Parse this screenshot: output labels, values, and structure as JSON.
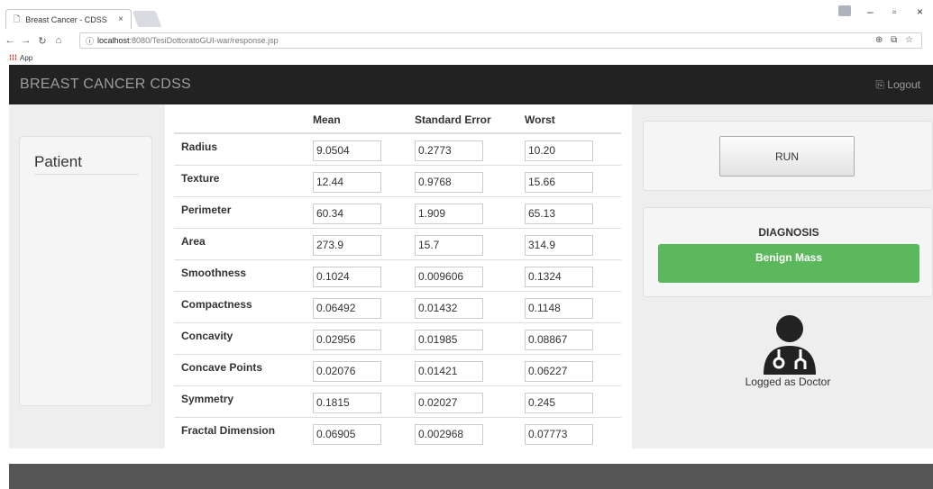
{
  "browser": {
    "tab_title": "Breast Cancer - CDSS",
    "tab_close": "×",
    "url_host": "localhost",
    "url_path": ":8080/TesiDottoratoGUI-war/response.jsp",
    "bookmark_app": "App",
    "window_min": "–",
    "window_max": "▫",
    "window_close": "×"
  },
  "navbar": {
    "brand": "BREAST CANCER CDSS",
    "logout_label": "Logout"
  },
  "patient": {
    "title": "Patient"
  },
  "table": {
    "headers": [
      "",
      "Mean",
      "Standard Error",
      "Worst"
    ],
    "rows": [
      {
        "label": "Radius",
        "mean": "9.0504",
        "se": "0.2773",
        "worst": "10.20"
      },
      {
        "label": "Texture",
        "mean": "12.44",
        "se": "0.9768",
        "worst": "15.66"
      },
      {
        "label": "Perimeter",
        "mean": "60.34",
        "se": "1.909",
        "worst": "65.13"
      },
      {
        "label": "Area",
        "mean": "273.9",
        "se": "15.7",
        "worst": "314.9"
      },
      {
        "label": "Smoothness",
        "mean": "0.1024",
        "se": "0.009606",
        "worst": "0.1324"
      },
      {
        "label": "Compactness",
        "mean": "0.06492",
        "se": "0.01432",
        "worst": "0.1148"
      },
      {
        "label": "Concavity",
        "mean": "0.02956",
        "se": "0.01985",
        "worst": "0.08867"
      },
      {
        "label": "Concave Points",
        "mean": "0.02076",
        "se": "0.01421",
        "worst": "0.06227"
      },
      {
        "label": "Symmetry",
        "mean": "0.1815",
        "se": "0.02027",
        "worst": "0.245"
      },
      {
        "label": "Fractal Dimension",
        "mean": "0.06905",
        "se": "0.002968",
        "worst": "0.07773"
      }
    ]
  },
  "run": {
    "label": "RUN"
  },
  "diagnosis": {
    "title": "DIAGNOSIS",
    "result": "Benign Mass",
    "result_color": "#5cb85c"
  },
  "user": {
    "logged_as": "Logged as Doctor"
  }
}
